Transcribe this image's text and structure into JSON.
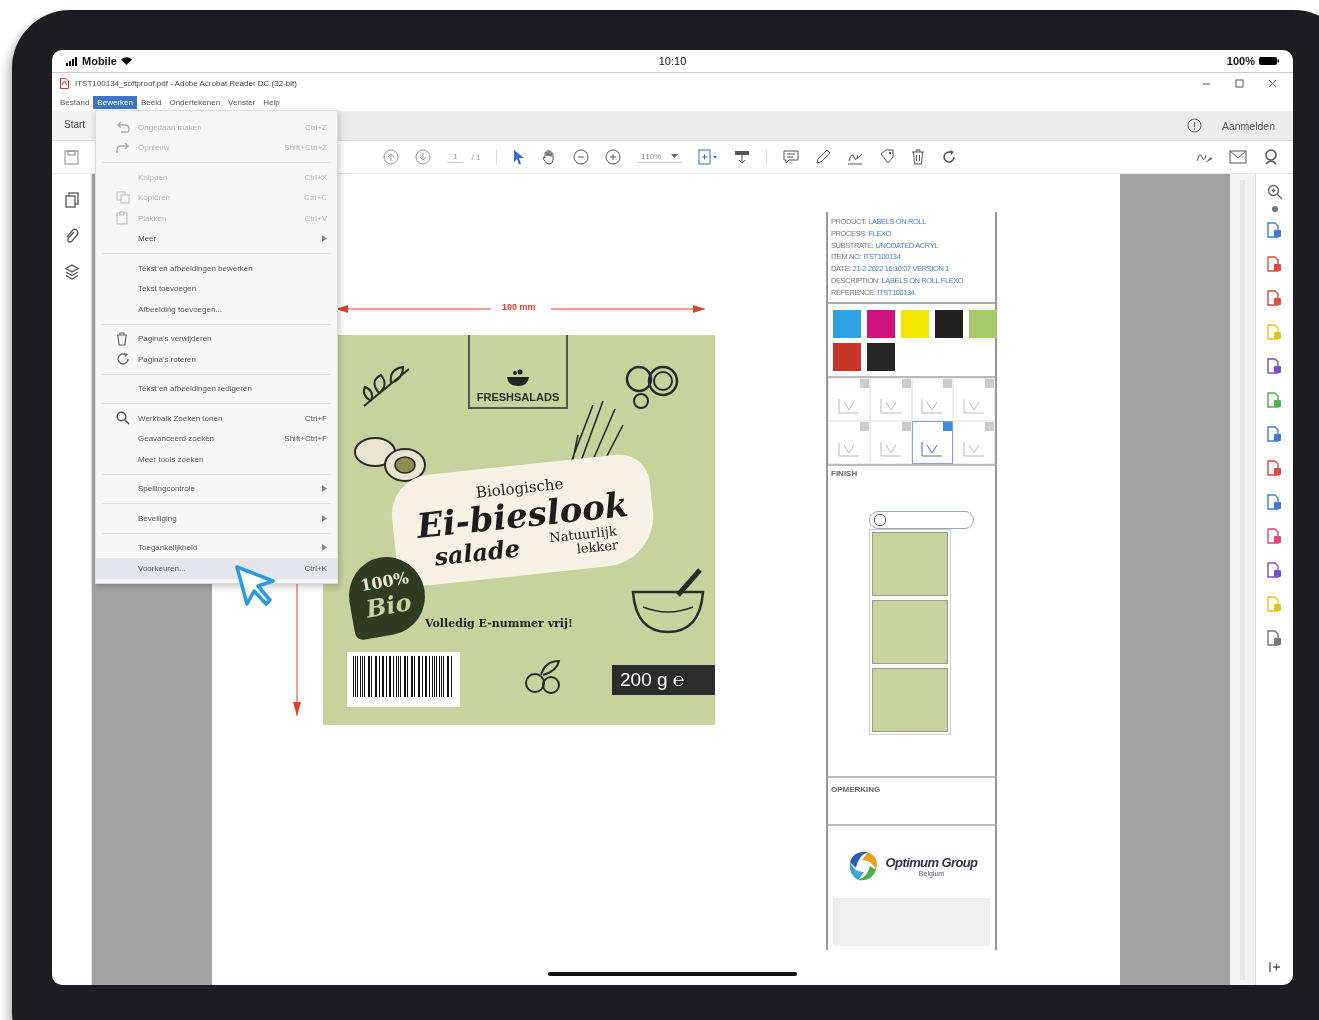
{
  "status_bar": {
    "carrier": "Mobile",
    "time": "10:10",
    "battery": "100%"
  },
  "window": {
    "title": "ITST100134_softproof.pdf - Adobe Acrobat Reader DC (32-bit)"
  },
  "menu_bar": [
    {
      "label": "Bestand",
      "selected": false
    },
    {
      "label": "Bewerken",
      "selected": true
    },
    {
      "label": "Beeld",
      "selected": false
    },
    {
      "label": "Ondertekenen",
      "selected": false
    },
    {
      "label": "Venster",
      "selected": false
    },
    {
      "label": "Help",
      "selected": false
    }
  ],
  "tabs": [
    {
      "label": "Start",
      "selected": true
    }
  ],
  "sign_in": "Aanmelden",
  "toolbar": {
    "page": "1",
    "page_count": "/ 1",
    "zoom": "110%"
  },
  "edit_menu": [
    [
      {
        "label": "Ongedaan maken",
        "shortcut": "Ctrl+Z",
        "kind": "undo",
        "disabled": true,
        "submenu": false,
        "highlighted": false
      },
      {
        "label": "Opnieuw",
        "shortcut": "Shift+Ctrl+Z",
        "kind": "redo",
        "disabled": true,
        "submenu": false,
        "highlighted": false
      }
    ],
    [
      {
        "label": "Knippen",
        "shortcut": "Ctrl+X",
        "disabled": true,
        "submenu": false,
        "highlighted": false
      },
      {
        "label": "Kopiëren",
        "shortcut": "Ctrl+C",
        "kind": "copy",
        "disabled": true,
        "submenu": false,
        "highlighted": false
      },
      {
        "label": "Plakken",
        "shortcut": "Ctrl+V",
        "kind": "paste",
        "disabled": true,
        "submenu": false,
        "highlighted": false
      },
      {
        "label": "Meer",
        "disabled": false,
        "submenu": true,
        "highlighted": false
      }
    ],
    [
      {
        "label": "Tekst en afbeeldingen bewerken",
        "disabled": false,
        "submenu": false,
        "highlighted": false
      },
      {
        "label": "Tekst toevoegen",
        "disabled": false,
        "submenu": false,
        "highlighted": false
      },
      {
        "label": "Afbeelding toevoegen...",
        "disabled": false,
        "submenu": false,
        "highlighted": false
      }
    ],
    [
      {
        "label": "Pagina's verwijderen",
        "kind": "trash",
        "disabled": false,
        "submenu": false,
        "highlighted": false
      },
      {
        "label": "Pagina's roteren",
        "kind": "rotate",
        "disabled": false,
        "submenu": false,
        "highlighted": false
      }
    ],
    [
      {
        "label": "Tekst en afbeeldingen redigeren",
        "disabled": false,
        "submenu": false,
        "highlighted": false
      }
    ],
    [
      {
        "label": "Werkbalk Zoeken tonen",
        "shortcut": "Ctrl+F",
        "kind": "search",
        "disabled": false,
        "submenu": false,
        "highlighted": false
      },
      {
        "label": "Geavanceerd zoeken",
        "shortcut": "Shift+Ctrl+F",
        "disabled": false,
        "submenu": false,
        "highlighted": false
      },
      {
        "label": "Meer tools zoeken",
        "disabled": false,
        "submenu": false,
        "highlighted": false
      }
    ],
    [
      {
        "label": "Spellingcontrole",
        "disabled": false,
        "submenu": true,
        "highlighted": false
      }
    ],
    [
      {
        "label": "Beveiliging",
        "disabled": false,
        "submenu": true,
        "highlighted": false
      }
    ],
    [
      {
        "label": "Toegankelijkheid",
        "disabled": false,
        "submenu": true,
        "highlighted": false
      },
      {
        "label": "Voorkeuren...",
        "shortcut": "Ctrl+K",
        "disabled": false,
        "submenu": false,
        "highlighted": true
      }
    ]
  ],
  "label_artwork": {
    "dimension": "100 mm",
    "brand": "FRESHSALADS",
    "subtitle": "Biologische",
    "name": "Ei-bieslook",
    "name_2": "salade",
    "tagline": "Natuurlijk lekker",
    "badge_1": "100%",
    "badge_2": "Bio",
    "claim": "Volledig E-nummer vrij!",
    "weight": "200 g ℮"
  },
  "proof_sheet": {
    "info": [
      {
        "label": "PRODUCT:",
        "value": "LABELS ON ROLL"
      },
      {
        "label": "PROCESS:",
        "value": "FLEXO"
      },
      {
        "label": "SUBSTRATE:",
        "value": "UNCOATED ACRYL"
      },
      {
        "label": "ITEM NO:",
        "value": "ITST100134"
      },
      {
        "label": "DATE:",
        "value": "21-2-2022 16:10:07 VERSION 1"
      },
      {
        "label": "DESCRIPTION:",
        "value": "LABELS ON ROLL FLEXO"
      },
      {
        "label": "REFERENCE:",
        "value": "ITST100134"
      }
    ],
    "swatches": [
      {
        "color": "#2aa3e0"
      },
      {
        "color": "#d0127f"
      },
      {
        "color": "#f3e600"
      },
      {
        "color": "#222222"
      },
      {
        "color": "#a8c96a"
      },
      {
        "color": "#c8362b"
      },
      {
        "color": "#262626"
      }
    ],
    "thumbnails": [
      {
        "selected": false
      },
      {
        "selected": false
      },
      {
        "selected": false
      },
      {
        "selected": false
      },
      {
        "selected": false
      },
      {
        "selected": false
      },
      {
        "selected": true
      },
      {
        "selected": false
      }
    ],
    "finish_label": "FINISH",
    "remarks_label": "OPMERKING",
    "logo": "Optimum Group",
    "logo_sub": "Belgium"
  },
  "tools": [
    {
      "color": "#777777"
    },
    {
      "color": "#3b7dd8"
    },
    {
      "color": "#e04a3f"
    },
    {
      "color": "#e04a3f"
    },
    {
      "color": "#e8c21a"
    },
    {
      "color": "#7a4fc8"
    },
    {
      "color": "#4caf50"
    },
    {
      "color": "#3b7dd8"
    },
    {
      "color": "#e04a3f"
    },
    {
      "color": "#3b7dd8"
    },
    {
      "color": "#e0457a"
    },
    {
      "color": "#7a4fc8"
    },
    {
      "color": "#e8c21a"
    },
    {
      "color": "#777777"
    }
  ]
}
